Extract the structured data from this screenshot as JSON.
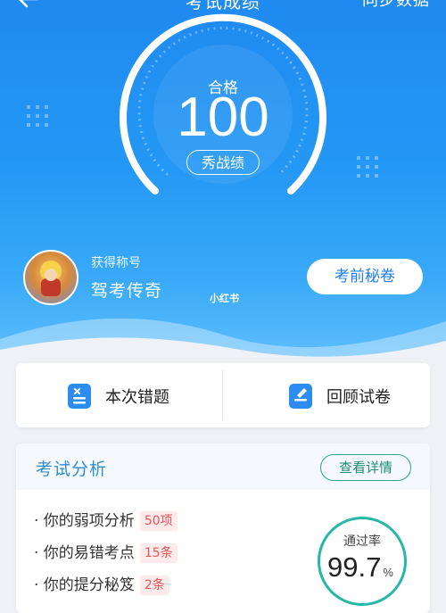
{
  "topbar": {
    "title": "考试成绩",
    "sync": "同步数据"
  },
  "score": {
    "label": "合格",
    "value": "100",
    "grade": "秀战绩"
  },
  "achievement": {
    "label": "获得称号",
    "value": "驾考传奇",
    "watermark": "小红书"
  },
  "prep_button": "考前秘卷",
  "actions": [
    {
      "label": "本次错题",
      "icon": "wrong-questions-icon",
      "color": "#2d8cf0"
    },
    {
      "label": "回顾试卷",
      "icon": "review-paper-icon",
      "color": "#2d8cf0"
    }
  ],
  "analysis": {
    "title": "考试分析",
    "detail_button": "查看详情",
    "items": [
      {
        "text": "· 你的弱项分析",
        "tag": "50项"
      },
      {
        "text": "· 你的易错考点",
        "tag": "15条"
      },
      {
        "text": "· 你的提分秘笈",
        "tag": "2条"
      }
    ],
    "pass_rate": {
      "label": "通过率",
      "value": "99.7",
      "unit": "%"
    }
  },
  "colors": {
    "hero_blue": "#2498f5",
    "accent_teal": "#27b7a8",
    "tag_red": "#e4545a"
  }
}
